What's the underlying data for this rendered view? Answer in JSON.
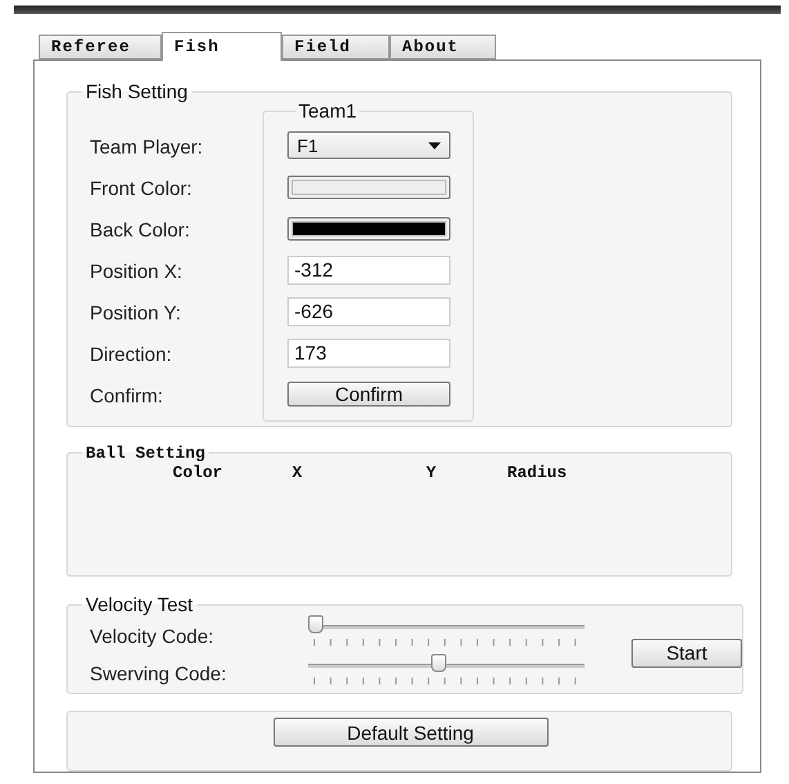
{
  "tabs": [
    {
      "label": "Referee",
      "selected": false
    },
    {
      "label": "Fish",
      "selected": true
    },
    {
      "label": "Field",
      "selected": false
    },
    {
      "label": "About",
      "selected": false
    }
  ],
  "fish_setting": {
    "title": "Fish Setting",
    "team_group": "Team1",
    "rows": [
      {
        "kind": "dropdown",
        "label": "Team Player:",
        "value": "F1"
      },
      {
        "kind": "color",
        "label": "Front Color:",
        "color": "#eeeeee"
      },
      {
        "kind": "color",
        "label": "Back Color:",
        "color": "#000000"
      },
      {
        "kind": "input",
        "label": "Position X:",
        "value": "-312"
      },
      {
        "kind": "input",
        "label": "Position Y:",
        "value": "-626"
      },
      {
        "kind": "input",
        "label": "Direction:",
        "value": "173"
      },
      {
        "kind": "button",
        "label": "Confirm:",
        "button": "Confirm"
      }
    ]
  },
  "ball_setting": {
    "title": "Ball Setting",
    "columns": [
      "Color",
      "X",
      "Y",
      "Radius"
    ]
  },
  "velocity_test": {
    "title": "Velocity Test",
    "sliders": [
      {
        "label": "Velocity Code:",
        "level": 0
      },
      {
        "label": "Swerving Code:",
        "level": 0.47
      }
    ],
    "button": "Start"
  },
  "default_button": "Default Setting"
}
